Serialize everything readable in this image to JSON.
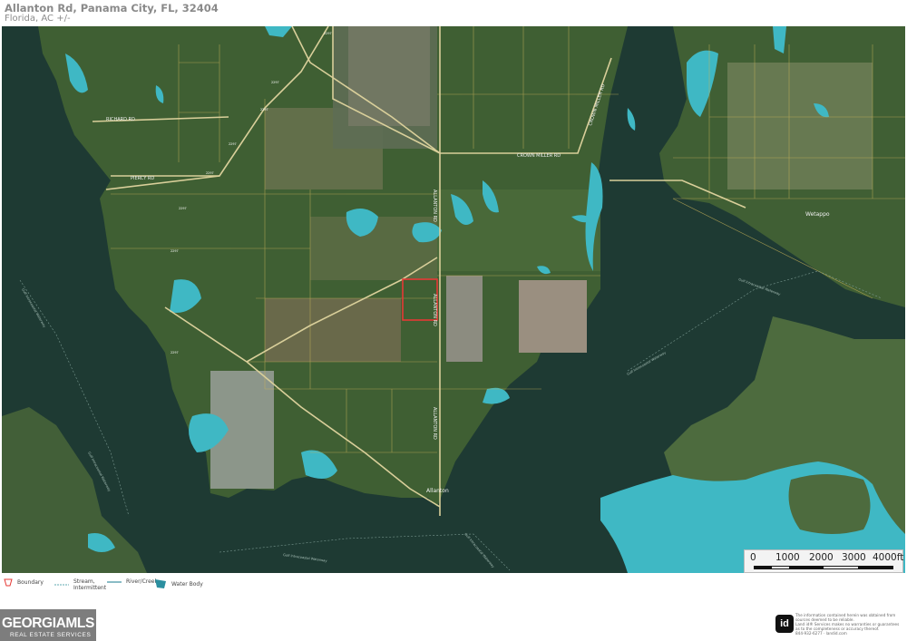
{
  "header": {
    "title": "Allanton Rd, Panama City, FL, 32404",
    "subtitle": "Florida,  AC +/-"
  },
  "map": {
    "water_color": "#1f3b33",
    "land_color": "#3a5a30",
    "wetland_color": "#3fb8c4",
    "boundary_color": "#e53935",
    "parcel_line_color": "#c9b45a",
    "labels": {
      "crown_miller_rd": "CROWN MILLER RD",
      "crown_miller_rd_ne": "CROWN MILLER RD",
      "allanton_rd_n": "ALLANTON RD",
      "allanton_rd_mid": "ALLANTON RD",
      "allanton_rd_s": "ALLANTON RD",
      "richard_rd": "RICHARD RD",
      "piercy_rd": "PIERCY RD",
      "wetappo": "Wetappo",
      "allanton": "Allanton",
      "intracoastal_1": "Gulf Intracoastal Waterway",
      "intracoastal_2": "Gulf Intracoastal Waterway",
      "intracoastal_3": "Gulf Intracoastal Waterway",
      "intracoastal_4": "Gulf Intracoastal Waterway",
      "intracoastal_5": "Gulf Intracoastal Waterway",
      "intracoastal_6": "Gulf Intracoastal Waterway",
      "cr_2297_a": "2297",
      "cr_2297_b": "2297",
      "cr_2297_c": "2297",
      "cr_2297_d": "2297",
      "cr_2297_e": "2297",
      "cr_2297_f": "2297",
      "cr_2297_g": "2297",
      "cr_2297_h": "2297"
    }
  },
  "scale": {
    "labels": [
      "0",
      "1000",
      "2000",
      "3000",
      "4000ft"
    ]
  },
  "legend": {
    "boundary": "Boundary",
    "stream": "Stream, Intermittent",
    "river": "River/Creek",
    "water_body": "Water Body"
  },
  "logo": {
    "main": "GEORGIAMLS",
    "sub": "REAL ESTATE SERVICES"
  },
  "disclaimer": {
    "badge": "id",
    "line1": "The information contained herein was obtained from",
    "line2": "sources deemed to be reliable.",
    "line3": "Land id® Services makes no warranties or guarantees",
    "line4": "as to the completeness or accuracy thereof.",
    "line5": "844-932-6277 · landid.com"
  }
}
